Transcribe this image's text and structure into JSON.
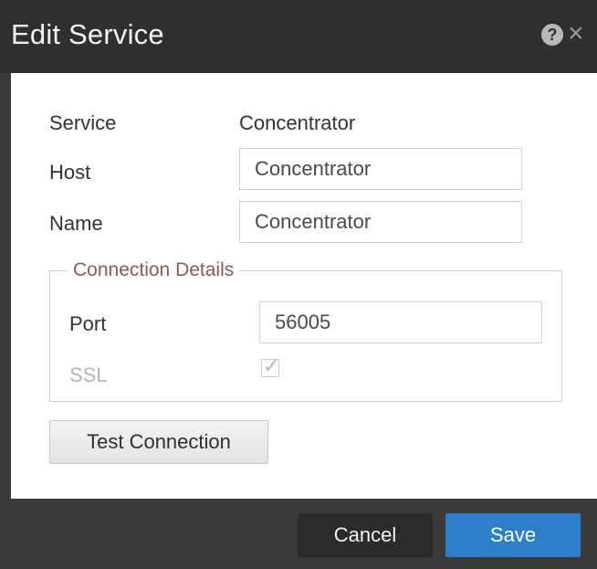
{
  "dialog": {
    "title": "Edit Service",
    "help_icon": "help-icon",
    "close_icon": "close-icon"
  },
  "form": {
    "service": {
      "label": "Service",
      "value": "Concentrator"
    },
    "host": {
      "label": "Host",
      "value": "Concentrator"
    },
    "name": {
      "label": "Name",
      "value": "Concentrator"
    },
    "connection_details": {
      "legend": "Connection Details",
      "port": {
        "label": "Port",
        "value": "56005"
      },
      "ssl": {
        "label": "SSL",
        "checked": true,
        "disabled": true
      }
    },
    "test_button": "Test Connection"
  },
  "footer": {
    "cancel": "Cancel",
    "save": "Save"
  },
  "colors": {
    "titlebar": "#2f2f2f",
    "footer": "#3a3a3a",
    "save_button": "#2d7fca",
    "cancel_button": "#2b2b2b",
    "legend_text": "#8a5a5a"
  }
}
